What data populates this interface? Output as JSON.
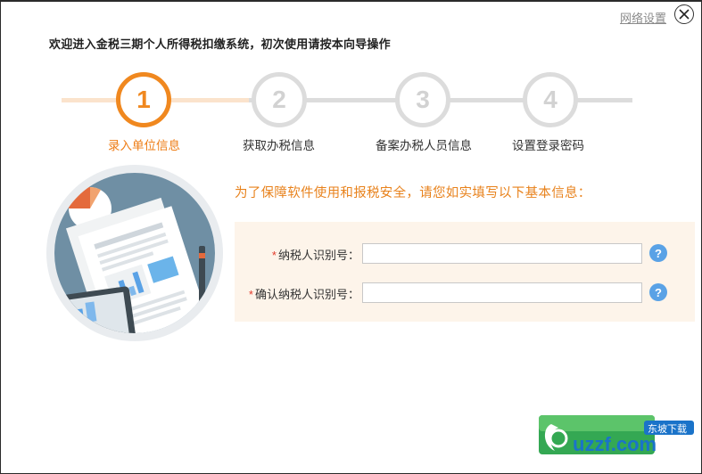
{
  "header": {
    "network_settings_label": "网络设置",
    "welcome_text": "欢迎进入金税三期个人所得税扣缴系统，初次使用请按本向导操作"
  },
  "steps": [
    {
      "number": "1",
      "label": "录入单位信息",
      "state": "active"
    },
    {
      "number": "2",
      "label": "获取办税信息",
      "state": "inactive"
    },
    {
      "number": "3",
      "label": "备案办税人员信息",
      "state": "inactive"
    },
    {
      "number": "4",
      "label": "设置登录密码",
      "state": "inactive"
    }
  ],
  "form": {
    "notice": "为了保障软件使用和报税安全，请您如实填写以下基本信息：",
    "fields": [
      {
        "required_mark": "*",
        "label": "纳税人识别号：",
        "value": "",
        "help": "?"
      },
      {
        "required_mark": "*",
        "label": "确认纳税人识别号：",
        "value": "",
        "help": "?"
      }
    ]
  },
  "watermark": {
    "site_text": "uzzf.com",
    "tag_text": "东坡下载"
  },
  "colors": {
    "accent_orange": "#f0881f",
    "inactive_gray": "#dcdcdc",
    "help_blue": "#5aa2e6",
    "required_red": "#e23a2a",
    "panel_bg": "#fdf4ea"
  }
}
